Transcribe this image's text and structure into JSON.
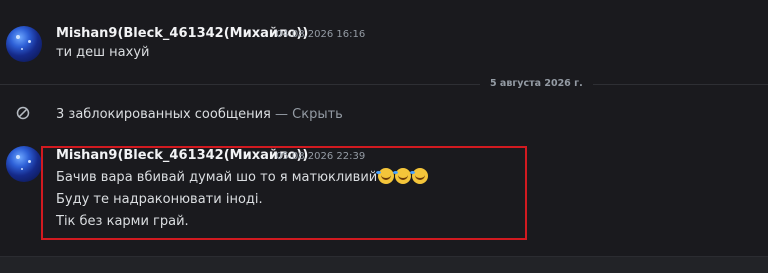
{
  "messages": [
    {
      "username": "Mishan9(Bleck_461342(Михайло))",
      "timestamp": "04.08.2026 16:16",
      "lines": [
        "ти деш нахуй"
      ]
    },
    {
      "username": "Mishan9(Bleck_461342(Михайло))",
      "timestamp": "05.08.2026 22:39",
      "lines": [
        "Бачив вара вбивай думай шо то я матюкливий",
        "Буду те надраконювати іноді.",
        "Тік без карми грай."
      ],
      "emojis": [
        "rolling-on-floor-laughing",
        "rolling-on-floor-laughing",
        "rolling-on-floor-laughing"
      ]
    }
  ],
  "date_divider": "5 августа 2026 г.",
  "blocked": {
    "text": "3 заблокированных сообщения",
    "separator": " — ",
    "action": "Скрыть"
  },
  "colors": {
    "background": "#1a1a1e",
    "highlight_border": "#d21a20",
    "username": "#f2f3f5",
    "muted": "#949ba4"
  }
}
